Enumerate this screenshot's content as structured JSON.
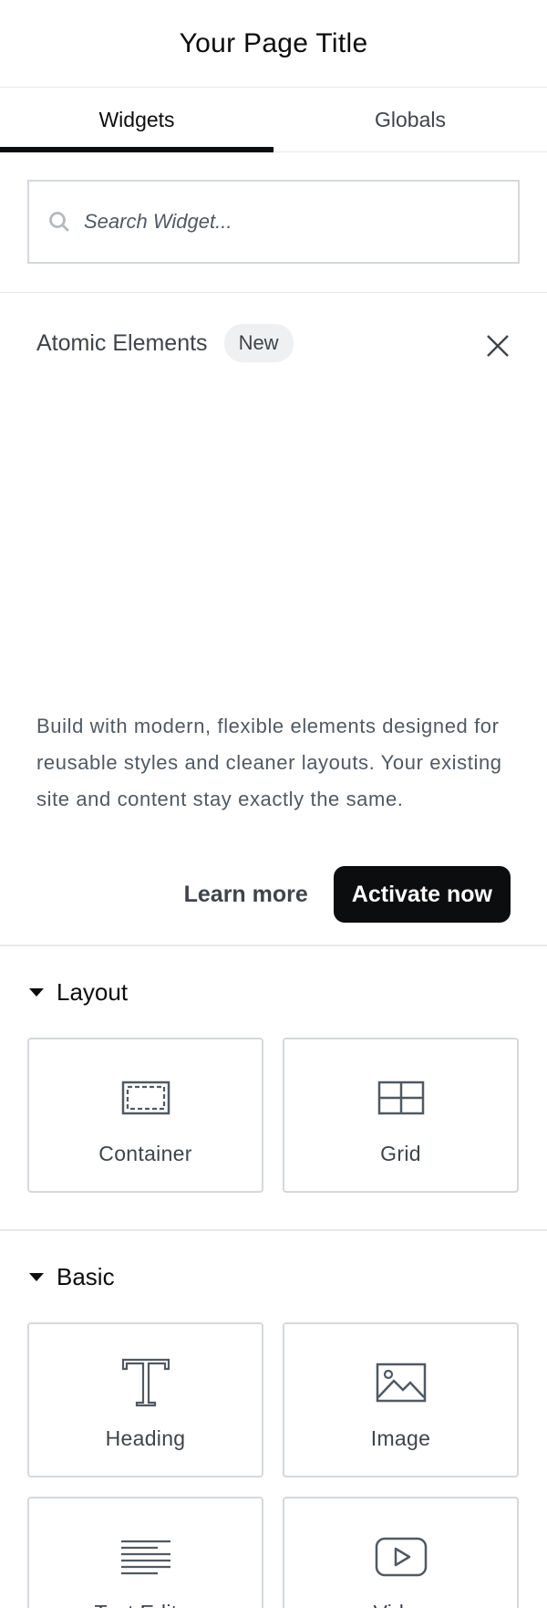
{
  "header": {
    "title": "Your Page Title"
  },
  "tabs": [
    {
      "label": "Widgets"
    },
    {
      "label": "Globals"
    }
  ],
  "search": {
    "placeholder": "Search Widget..."
  },
  "atomic": {
    "title": "Atomic Elements",
    "badge": "New",
    "description": "Build with modern, flexible elements designed for reusable styles and cleaner layouts. Your existing site and content stay exactly the same.",
    "learn_more": "Learn more",
    "activate": "Activate now"
  },
  "layout": {
    "title": "Layout",
    "widgets": [
      {
        "label": "Container",
        "icon": "container-icon"
      },
      {
        "label": "Grid",
        "icon": "grid-icon"
      }
    ]
  },
  "basic": {
    "title": "Basic",
    "widgets": [
      {
        "label": "Heading",
        "icon": "heading-icon"
      },
      {
        "label": "Image",
        "icon": "image-icon"
      },
      {
        "label": "Text Editor",
        "icon": "text-editor-icon"
      },
      {
        "label": "Video",
        "icon": "video-icon"
      }
    ]
  },
  "colors": {
    "accent": "#0c0d0e",
    "border": "#d5d8dc",
    "text": "#3f444b",
    "muted": "#515962"
  }
}
